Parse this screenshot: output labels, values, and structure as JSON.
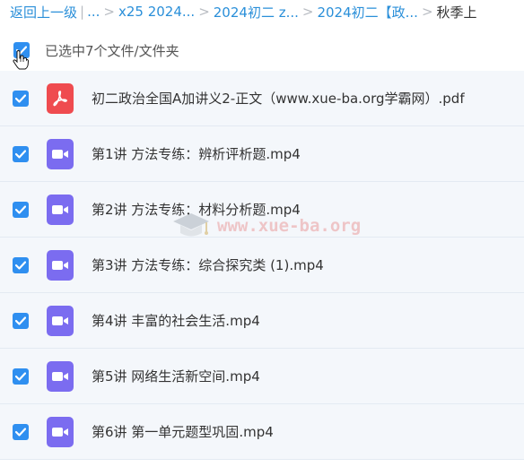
{
  "breadcrumb": {
    "back": "返回上一级",
    "ellipsis": "...",
    "items": [
      "x25 2024...",
      "2024初二 z...",
      "2024初二【政..."
    ],
    "current": "秋季上"
  },
  "select_all": {
    "label": "已选中7个文件/文件夹",
    "checked": true
  },
  "files": [
    {
      "name": "初二政治全国A加讲义2-正文（www.xue-ba.org学霸网）.pdf",
      "type": "pdf",
      "checked": true
    },
    {
      "name": "第1讲 方法专练：辨析评析题.mp4",
      "type": "video",
      "checked": true
    },
    {
      "name": "第2讲 方法专练：材料分析题.mp4",
      "type": "video",
      "checked": true
    },
    {
      "name": "第3讲 方法专练：综合探究类 (1).mp4",
      "type": "video",
      "checked": true
    },
    {
      "name": "第4讲 丰富的社会生活.mp4",
      "type": "video",
      "checked": true
    },
    {
      "name": "第5讲 网络生活新空间.mp4",
      "type": "video",
      "checked": true
    },
    {
      "name": "第6讲 第一单元题型巩固.mp4",
      "type": "video",
      "checked": true
    }
  ],
  "watermark": {
    "text": "www.xue-ba.org"
  },
  "colors": {
    "link": "#2a8fd9",
    "checkbox": "#2f8ff0",
    "pdf_icon": "#ef4b4f",
    "video_icon": "#7b6cf0",
    "row_bg": "#f4f7fb"
  },
  "icons": {
    "pdf": "pdf-file-icon",
    "video": "video-file-icon",
    "check": "checkmark-icon",
    "cursor": "hand-pointer-icon"
  }
}
